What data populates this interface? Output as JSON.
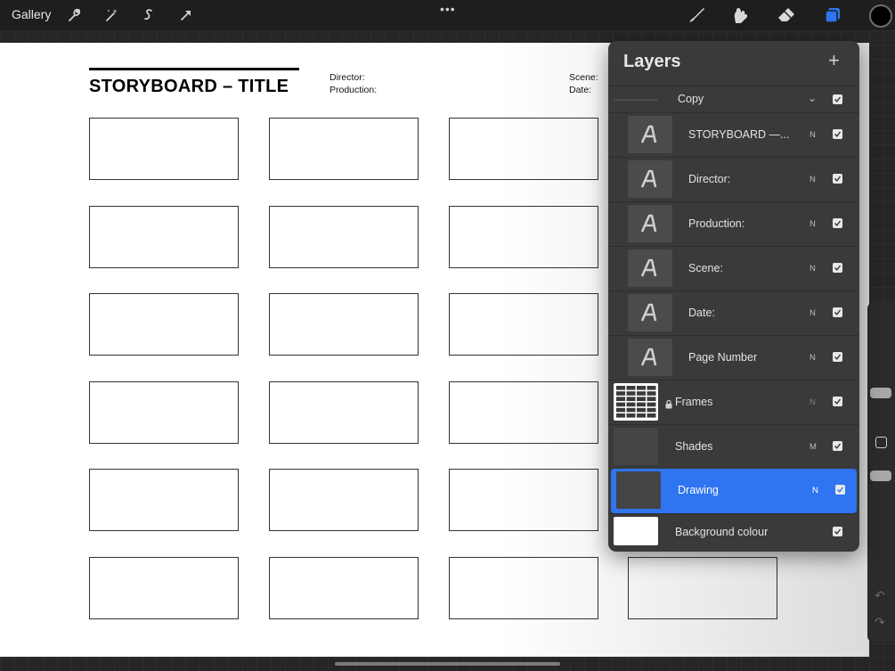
{
  "toolbar": {
    "gallery_label": "Gallery",
    "more_label": "•••",
    "left_tools": [
      "wrench-icon",
      "magic-wand-icon",
      "selection-icon",
      "transform-arrow-icon"
    ],
    "right_tools": [
      "brush-icon",
      "smudge-icon",
      "eraser-icon",
      "layers-icon"
    ],
    "active_tool_color": "#2f74f0",
    "current_color": "#000000"
  },
  "document": {
    "title": "STORYBOARD – TITLE",
    "director_label": "Director:",
    "production_label": "Production:",
    "scene_label": "Scene:",
    "date_label": "Date:",
    "frame_rows": 6,
    "frame_cols": 4
  },
  "layers_panel": {
    "title": "Layers",
    "add_label": "+",
    "group": {
      "name": "Copy",
      "visible": true
    },
    "layers": [
      {
        "name": "STORYBOARD —...",
        "blend": "N",
        "visible": true,
        "type": "text"
      },
      {
        "name": "Director:",
        "blend": "N",
        "visible": true,
        "type": "text"
      },
      {
        "name": "Production:",
        "blend": "N",
        "visible": true,
        "type": "text"
      },
      {
        "name": "Scene:",
        "blend": "N",
        "visible": true,
        "type": "text"
      },
      {
        "name": "Date:",
        "blend": "N",
        "visible": true,
        "type": "text"
      },
      {
        "name": "Page Number",
        "blend": "N",
        "visible": true,
        "type": "text"
      },
      {
        "name": "Frames",
        "blend": "N",
        "visible": true,
        "type": "locked-image"
      },
      {
        "name": "Shades",
        "blend": "M",
        "visible": true,
        "type": "image"
      },
      {
        "name": "Drawing",
        "blend": "N",
        "visible": true,
        "type": "image",
        "selected": true
      },
      {
        "name": "Background colour",
        "blend": "",
        "visible": true,
        "type": "background"
      }
    ],
    "selected_color": "#2f74f0"
  }
}
